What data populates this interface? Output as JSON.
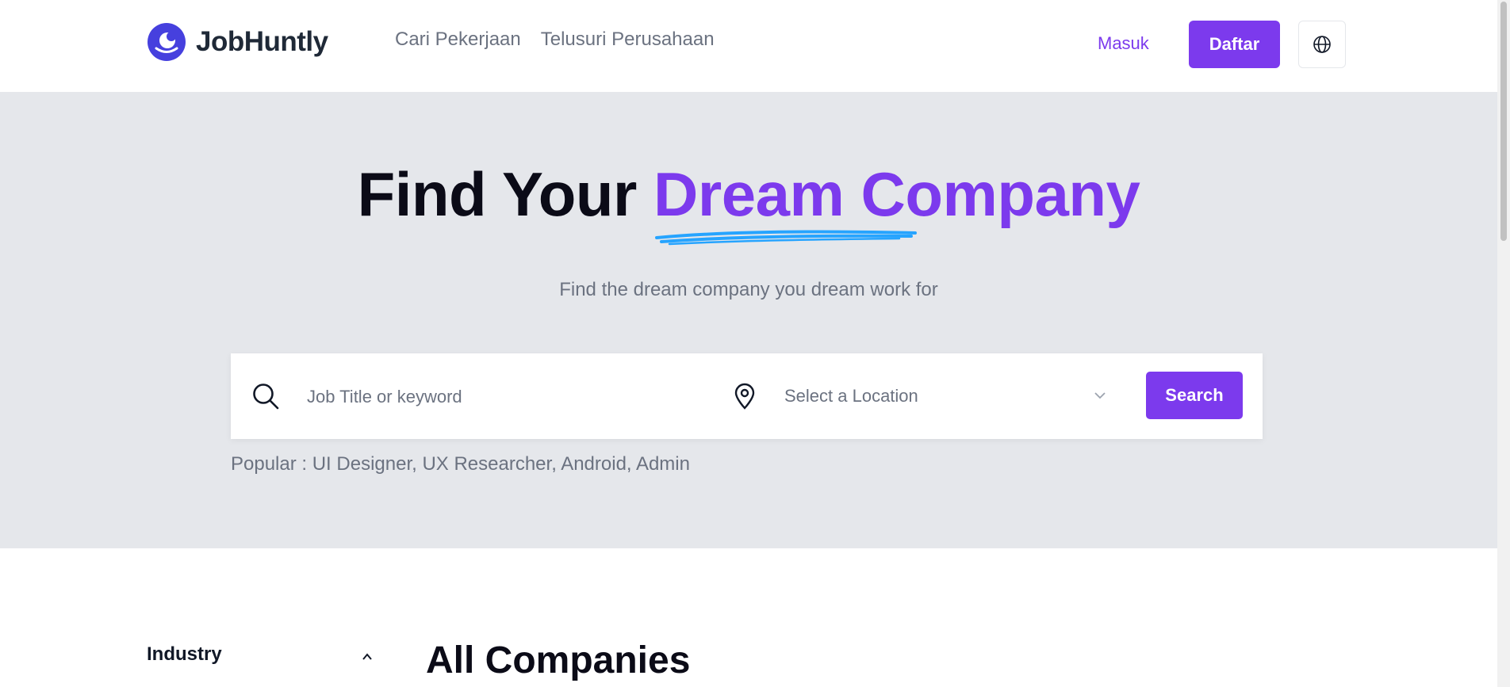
{
  "header": {
    "brand": "JobHuntly",
    "nav": [
      "Cari Pekerjaan",
      "Telusuri Perusahaan"
    ],
    "login_label": "Masuk",
    "signup_label": "Daftar",
    "language_icon": "globe-icon"
  },
  "hero": {
    "title_plain": "Find Your",
    "title_accent": "Dream Company",
    "subtitle": "Find the dream company you dream work for",
    "search": {
      "keyword_placeholder": "Job Title or keyword",
      "location_placeholder": "Select a Location",
      "button_label": "Search"
    },
    "popular": "Popular : UI Designer, UX Researcher, Android, Admin"
  },
  "filters": {
    "industry_label": "Industry"
  },
  "main": {
    "section_title": "All Companies"
  },
  "colors": {
    "accent": "#7c3aed",
    "hero_background": "#e5e7eb",
    "underline": "#26a4ff",
    "logo": "#4640de"
  }
}
